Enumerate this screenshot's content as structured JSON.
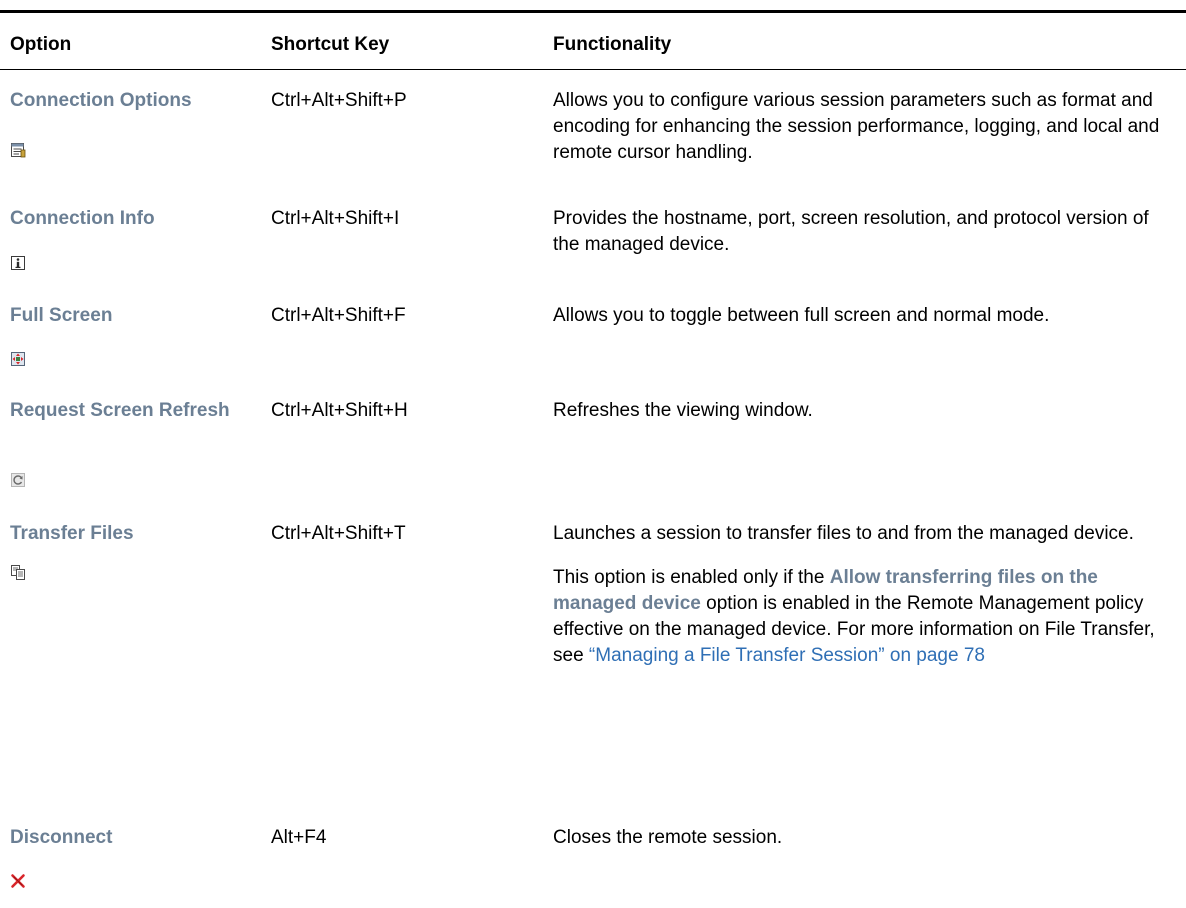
{
  "headers": {
    "option": "Option",
    "shortcut": "Shortcut Key",
    "functionality": "Functionality"
  },
  "rows": [
    {
      "option": "Connection Options",
      "icon": "properties-icon",
      "shortcut": "Ctrl+Alt+Shift+P",
      "functionality": "Allows you to configure various session parameters such as format and encoding for enhancing the session performance, logging, and local and remote cursor handling."
    },
    {
      "option": "Connection Info",
      "icon": "info-icon",
      "shortcut": "Ctrl+Alt+Shift+I",
      "functionality": "Provides the hostname, port, screen resolution, and protocol version of the managed device."
    },
    {
      "option": "Full Screen",
      "icon": "fullscreen-icon",
      "shortcut": "Ctrl+Alt+Shift+F",
      "functionality": "Allows you to toggle between full screen and normal mode."
    },
    {
      "option": "Request Screen Refresh",
      "icon": "refresh-icon",
      "shortcut": "Ctrl+Alt+Shift+H",
      "functionality": "Refreshes the viewing window."
    },
    {
      "option": "Transfer Files",
      "icon": "transfer-files-icon",
      "shortcut": "Ctrl+Alt+Shift+T",
      "functionality": "Launches a session to transfer files to and from the managed device.",
      "note_prefix": "This option is enabled only if the ",
      "note_bold": "Allow transferring files on the managed device",
      "note_middle": " option is enabled in the Remote Management policy effective on the managed device. For more information on File Transfer, see ",
      "note_link": "“Managing a File Transfer Session” on page 78"
    },
    {
      "option": "Disconnect",
      "icon": "disconnect-icon",
      "shortcut": "Alt+F4",
      "functionality": "Closes the remote session."
    }
  ],
  "colors": {
    "option_label": "#6b7f94",
    "link": "#2f6fb5",
    "disconnect_x": "#d9262b"
  }
}
